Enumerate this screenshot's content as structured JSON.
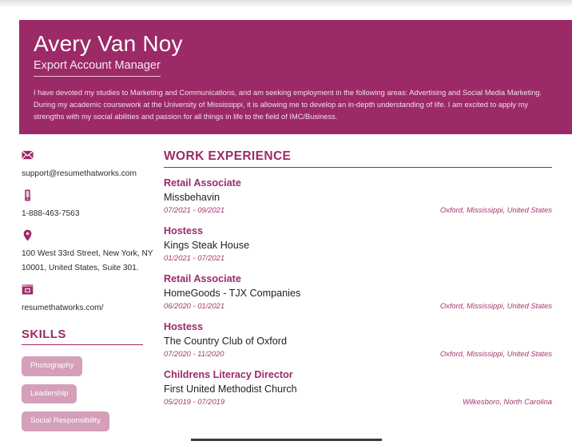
{
  "header": {
    "name": "Avery Van Noy",
    "job_title": "Export Account Manager",
    "summary": "I have devoted my studies to Marketing and Communications, and am seeking employment in the following areas: Advertising and Social Media Marketing. During my academic coursework at the University of Mississippi, it is allowing me to develop an in-depth understanding of life. I am excited to apply my strengths with my social abilities and passion for all things in life to the field of IMC/Business.",
    "band_color": "#9c2a66"
  },
  "sidebar": {
    "contacts": [
      {
        "icon": "envelope-icon",
        "value": "support@resumethatworks.com"
      },
      {
        "icon": "phone-icon",
        "value": "1-888-463-7563"
      },
      {
        "icon": "location-pin-icon",
        "value": "100 West 33rd Street, New York, NY 10001, United States, Suite 301."
      },
      {
        "icon": "browser-window-icon",
        "value": "resumethatworks.com/"
      }
    ],
    "skills_heading": "SKILLS",
    "skills": [
      "Photography",
      "Leadership",
      "Social Responsibility"
    ],
    "skill_pill_color": "#d49fb9"
  },
  "main": {
    "work_heading": "WORK EXPERIENCE",
    "experience": [
      {
        "role": "Retail Associate",
        "company": "Missbehavin",
        "dates": "07/2021 - 09/2021",
        "location": "Oxford, Mississippi, United States"
      },
      {
        "role": "Hostess",
        "company": "Kings Steak House",
        "dates": "01/2021 - 07/2021",
        "location": ""
      },
      {
        "role": "Retail Associate",
        "company": "HomeGoods - TJX Companies",
        "dates": "06/2020 - 01/2021",
        "location": "Oxford, Mississippi, United States"
      },
      {
        "role": "Hostess",
        "company": "The Country Club of Oxford",
        "dates": "07/2020 - 11/2020",
        "location": "Oxford, Mississippi, United States"
      },
      {
        "role": "Childrens Literacy Director",
        "company": "First United Methodist Church",
        "dates": "05/2019 - 07/2019",
        "location": "Wilkesboro, North Carolina"
      }
    ]
  }
}
